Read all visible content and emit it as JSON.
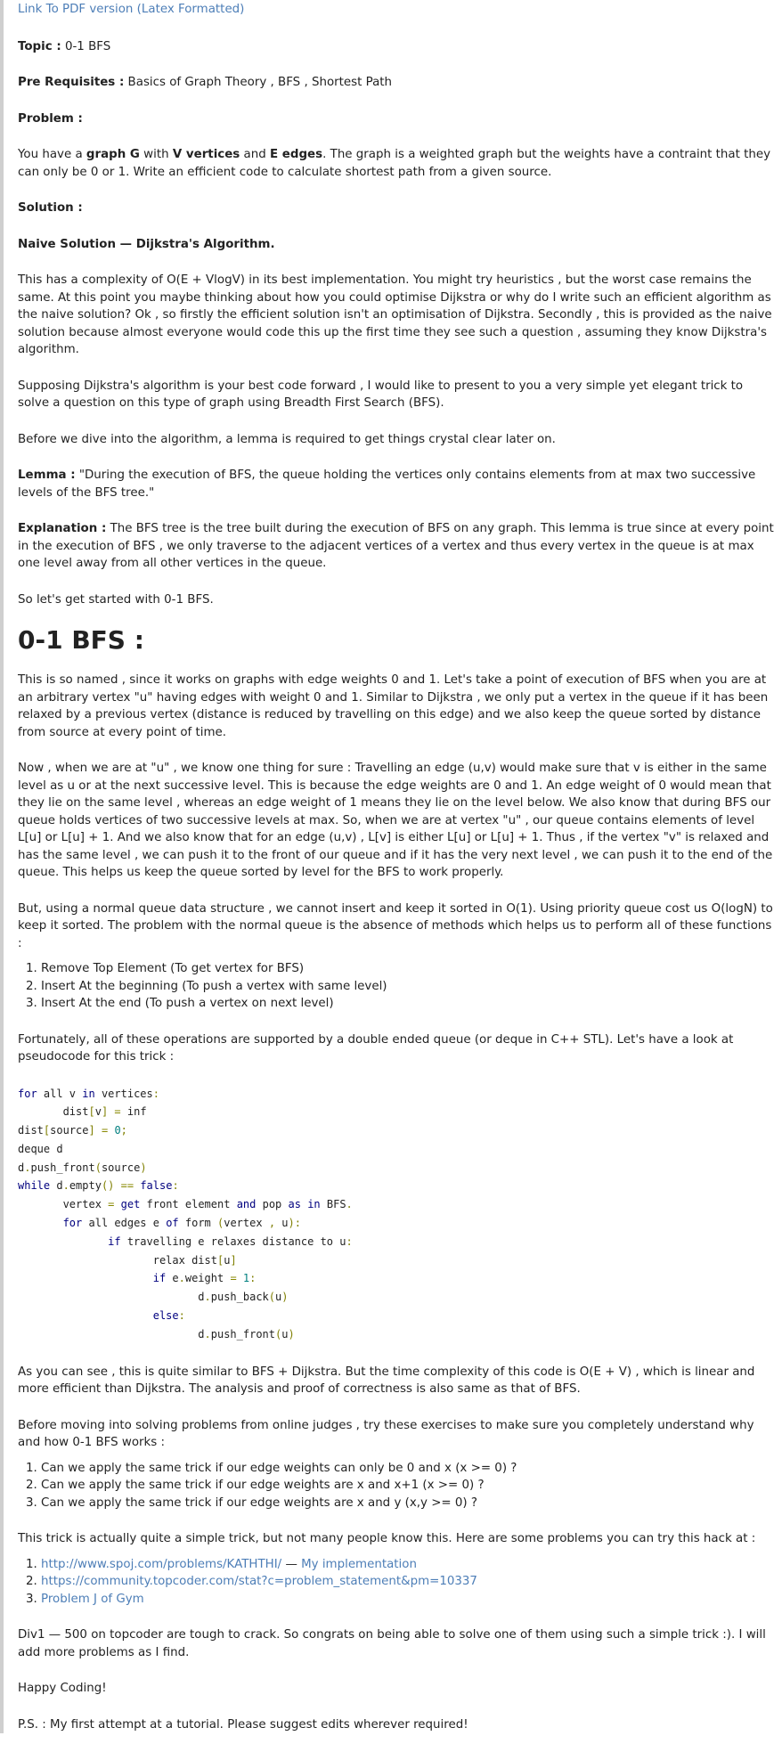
{
  "link_pdf": "Link To PDF version (Latex Formatted)",
  "topic": {
    "label": "Topic :",
    "value": " 0-1 BFS"
  },
  "prereq": {
    "label": "Pre Requisites :",
    "value": " Basics of Graph Theory , BFS , Shortest Path"
  },
  "problem_heading": "Problem :",
  "problem": {
    "t1": "You have a ",
    "b1": "graph G",
    "t2": " with ",
    "b2": "V vertices",
    "t3": " and ",
    "b3": "E edges",
    "t4": ". The graph is a weighted graph but the weights have a contraint that they can only be 0 or 1. Write an efficient code to calculate shortest path from a given source."
  },
  "solution_heading": "Solution :",
  "naive_heading": "Naive Solution — Dijkstra's Algorithm.",
  "para_complexity": "This has a complexity of O(E + VlogV) in its best implementation. You might try heuristics , but the worst case remains the same. At this point you maybe thinking about how you could optimise Dijkstra or why do I write such an efficient algorithm as the naive solution? Ok , so firstly the efficient solution isn't an optimisation of Dijkstra. Secondly , this is provided as the naive solution because almost everyone would code this up the first time they see such a question , assuming they know Dijkstra's algorithm.",
  "para_supposing": "Supposing Dijkstra's algorithm is your best code forward , I would like to present to you a very simple yet elegant trick to solve a question on this type of graph using Breadth First Search (BFS).",
  "para_before": "Before we dive into the algorithm, a lemma is required to get things crystal clear later on.",
  "lemma": {
    "label": "Lemma :",
    "text": " \"During the execution of BFS, the queue holding the vertices only contains elements from at max two successive levels of the BFS tree.\""
  },
  "explanation": {
    "label": "Explanation :",
    "text": " The BFS tree is the tree built during the execution of BFS on any graph. This lemma is true since at every point in the execution of BFS , we only traverse to the adjacent vertices of a vertex and thus every vertex in the queue is at max one level away from all other vertices in the queue."
  },
  "para_started": "So let's get started with 0-1 BFS.",
  "bfs_heading": "0-1 BFS :",
  "para_named": "This is so named , since it works on graphs with edge weights 0 and 1. Let's take a point of execution of BFS when you are at an arbitrary vertex \"u\" having edges with weight 0 and 1. Similar to Dijkstra , we only put a vertex in the queue if it has been relaxed by a previous vertex (distance is reduced by travelling on this edge) and we also keep the queue sorted by distance from source at every point of time.",
  "para_now": "Now , when we are at \"u\" , we know one thing for sure : Travelling an edge (u,v) would make sure that v is either in the same level as u or at the next successive level. This is because the edge weights are 0 and 1. An edge weight of 0 would mean that they lie on the same level , whereas an edge weight of 1 means they lie on the level below. We also know that during BFS our queue holds vertices of two successive levels at max. So, when we are at vertex \"u\" , our queue contains elements of level L[u] or L[u] + 1. And we also know that for an edge (u,v) , L[v] is either L[u] or L[u] + 1. Thus , if the vertex \"v\" is relaxed and has the same level , we can push it to the front of our queue and if it has the very next level , we can push it to the end of the queue. This helps us keep the queue sorted by level for the BFS to work properly.",
  "para_but": "But, using a normal queue data structure , we cannot insert and keep it sorted in O(1). Using priority queue cost us O(logN) to keep it sorted. The problem with the normal queue is the absence of methods which helps us to perform all of these functions :",
  "ops_list": [
    "Remove Top Element (To get vertex for BFS)",
    "Insert At the beginning (To push a vertex with same level)",
    "Insert At the end (To push a vertex on next level)"
  ],
  "para_fortunately": "Fortunately, all of these operations are supported by a double ended queue (or deque in C++ STL). Let's have a look at pseudocode for this trick :",
  "code": {
    "l1": [
      "for",
      " all v ",
      "in",
      " vertices",
      ":"
    ],
    "l2": [
      "       dist",
      "[",
      "v",
      "]",
      " ",
      "=",
      " inf"
    ],
    "l3": [
      "dist",
      "[",
      "source",
      "]",
      " ",
      "=",
      " ",
      "0",
      ";"
    ],
    "l4": [
      "deque d"
    ],
    "l5": [
      "d",
      ".",
      "push_front",
      "(",
      "source",
      ")"
    ],
    "l6": [
      "while",
      " d",
      ".",
      "empty",
      "()",
      " ",
      "==",
      " ",
      "false",
      ":"
    ],
    "l7": [
      "       vertex ",
      "=",
      " ",
      "get",
      " front element ",
      "and",
      " pop ",
      "as",
      " ",
      "in",
      " BFS",
      "."
    ],
    "l8": [
      "       ",
      "for",
      " all edges e ",
      "of",
      " form ",
      "(",
      "vertex ",
      ",",
      " u",
      ")",
      ":"
    ],
    "l9": [
      "              ",
      "if",
      " travelling e relaxes distance to u",
      ":"
    ],
    "l10": [
      "                     relax dist",
      "[",
      "u",
      "]"
    ],
    "l11": [
      "                     ",
      "if",
      " e",
      ".",
      "weight ",
      "=",
      " ",
      "1",
      ":"
    ],
    "l12": [
      "                            d",
      ".",
      "push_back",
      "(",
      "u",
      ")"
    ],
    "l13": [
      "                     ",
      "else",
      ":"
    ],
    "l14": [
      "                            d",
      ".",
      "push_front",
      "(",
      "u",
      ")"
    ]
  },
  "para_asyou": "As you can see , this is quite similar to BFS + Dijkstra. But the time complexity of this code is O(E + V) , which is linear and more efficient than Dijkstra. The analysis and proof of correctness is also same as that of BFS.",
  "para_moving": "Before moving into solving problems from online judges , try these exercises to make sure you completely understand why and how 0-1 BFS works :",
  "exercises": [
    "Can we apply the same trick if our edge weights can only be 0 and x (x >= 0) ?",
    "Can we apply the same trick if our edge weights are x and x+1 (x >= 0) ?",
    "Can we apply the same trick if our edge weights are x and y (x,y >= 0) ?"
  ],
  "para_trick": "This trick is actually quite a simple trick, but not many people know this. Here are some problems you can try this hack at :",
  "problems": {
    "p1_link": "http://www.spoj.com/problems/KATHTHI/",
    "p1_sep": " — ",
    "p1_impl": "My implementation",
    "p2_link": "https://community.topcoder.com/stat?c=problem_statement&pm=10337",
    "p3_link": "Problem J of Gym"
  },
  "para_div1": "Div1 — 500 on topcoder are tough to crack. So congrats on being able to solve one of them using such a simple trick :). I will add more problems as I find.",
  "para_happy": "Happy Coding!",
  "para_ps": "P.S. : My first attempt at a tutorial. Please suggest edits wherever required!",
  "colors": {
    "link": "#4d7eb7",
    "keyword": "#00007f",
    "number": "#007f7f",
    "operator": "#888800",
    "left_bar": "#cfcfcf"
  }
}
